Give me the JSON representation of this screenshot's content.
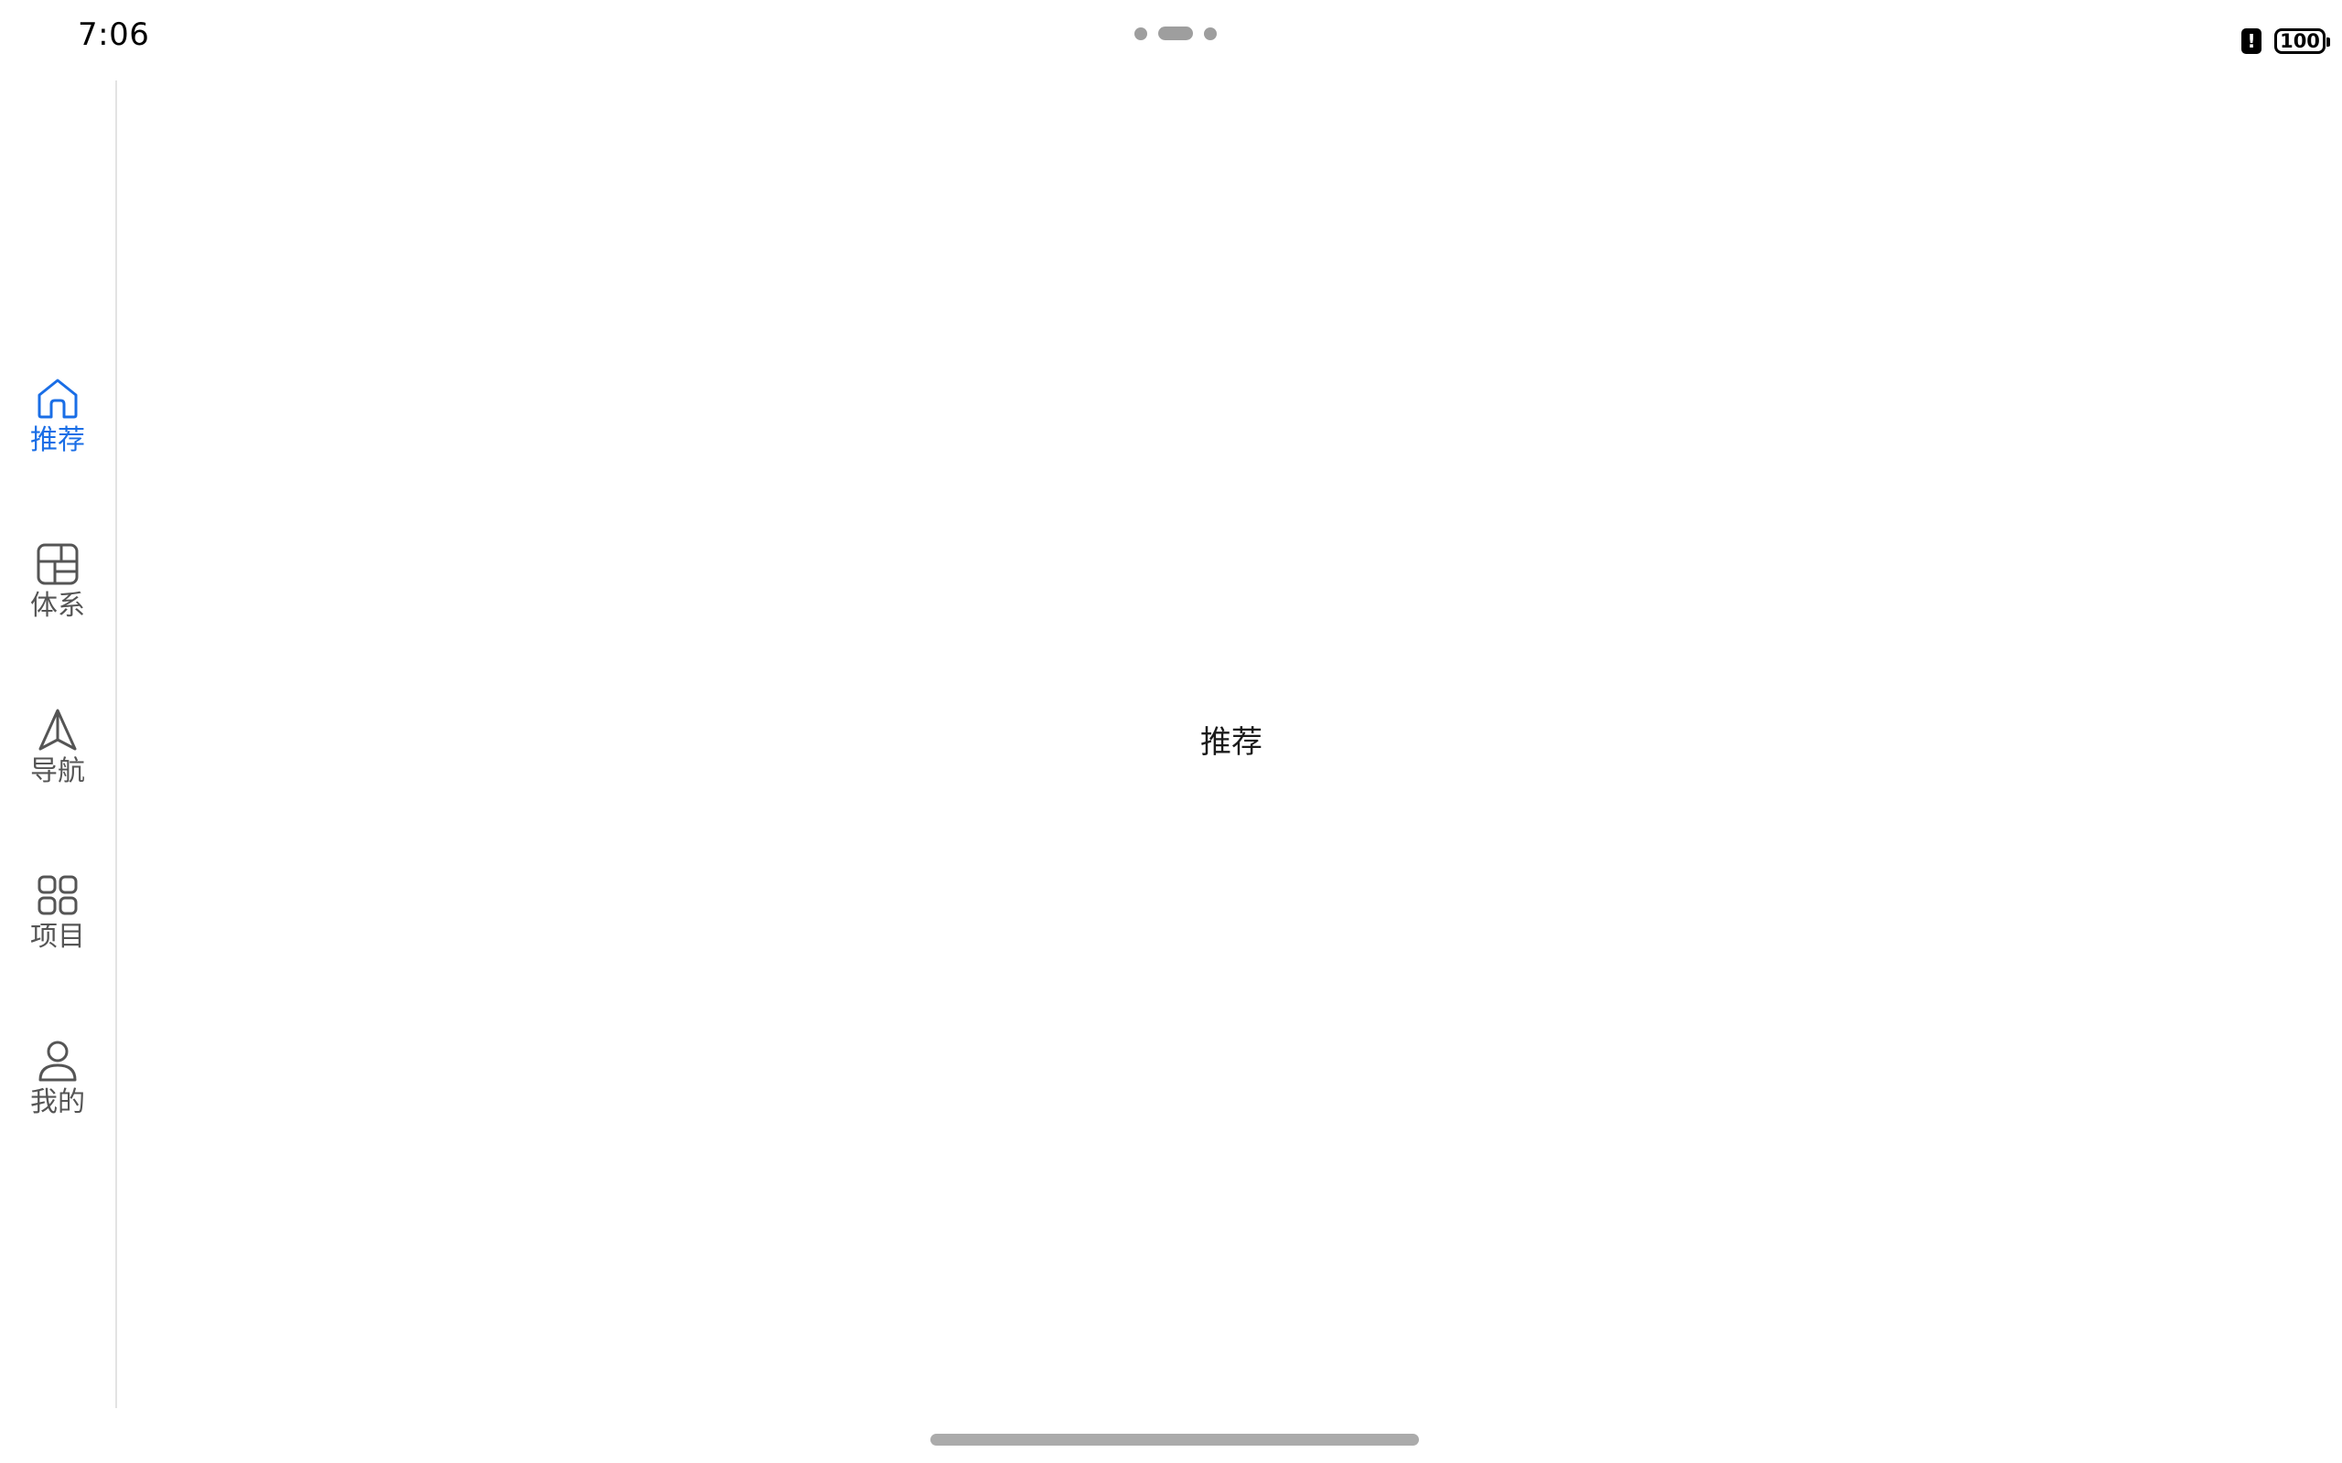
{
  "status_bar": {
    "time": "7:06",
    "battery_level": "100",
    "alert_glyph": "!"
  },
  "nav": {
    "items": [
      {
        "label": "推荐",
        "icon": "home-icon",
        "active": true
      },
      {
        "label": "体系",
        "icon": "layout-grid-icon",
        "active": false
      },
      {
        "label": "导航",
        "icon": "navigation-arrow-icon",
        "active": false
      },
      {
        "label": "项目",
        "icon": "apps-grid-icon",
        "active": false
      },
      {
        "label": "我的",
        "icon": "person-icon",
        "active": false
      }
    ]
  },
  "main": {
    "title": "推荐"
  },
  "colors": {
    "accent": "#1a6ee6",
    "inactive": "#555555",
    "divider": "#e3e3e3",
    "home_indicator": "#ababab"
  }
}
